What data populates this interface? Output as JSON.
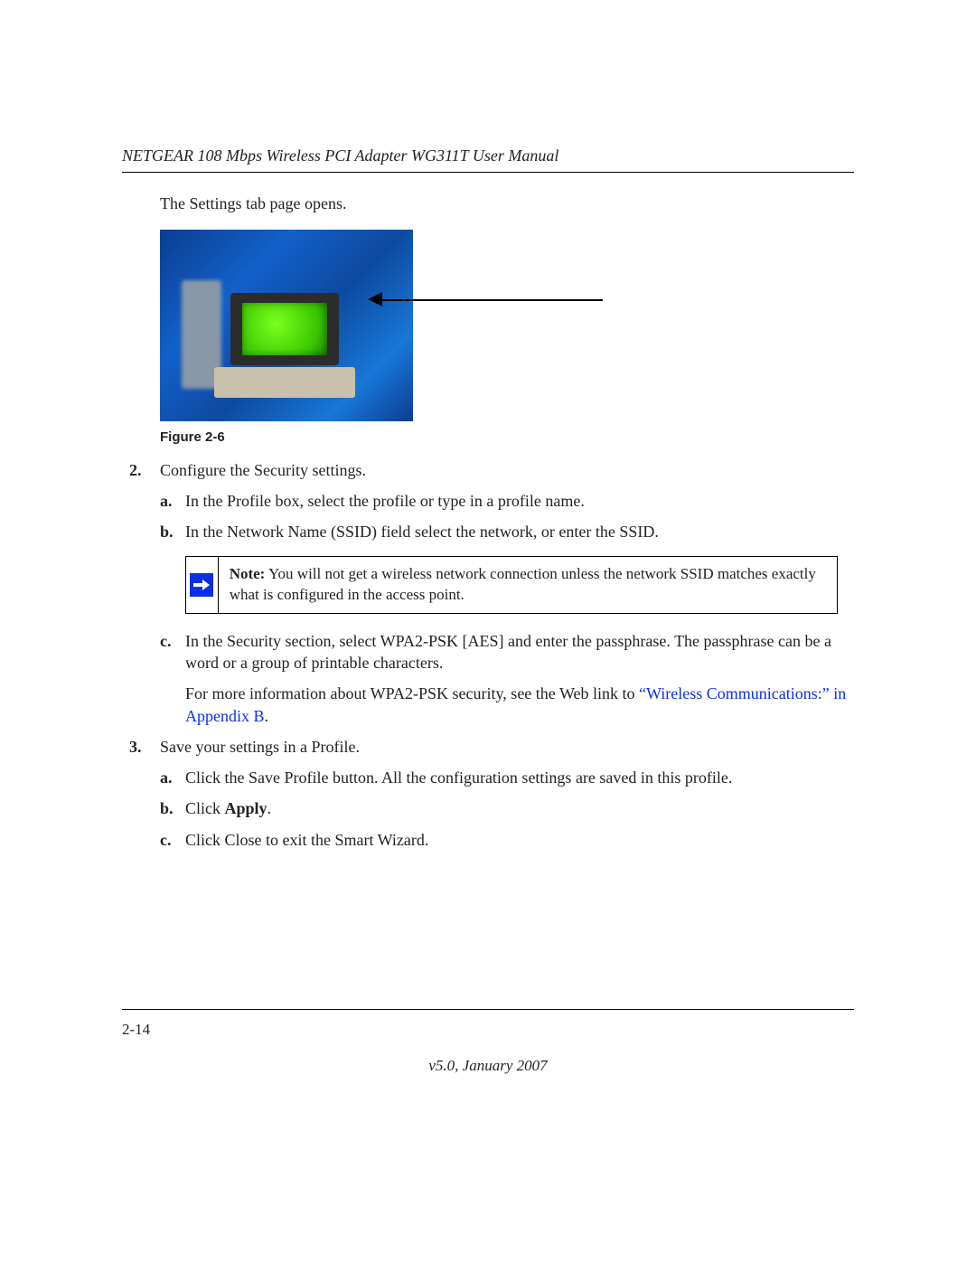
{
  "header": {
    "running_title": "NETGEAR 108 Mbps Wireless PCI Adapter WG311T User Manual"
  },
  "intro": "The Settings tab page opens.",
  "figure": {
    "caption": "Figure 2-6"
  },
  "steps": {
    "s2": {
      "marker": "2.",
      "text": "Configure the Security settings.",
      "a": {
        "marker": "a.",
        "text": "In the Profile box, select the profile or type in a profile name."
      },
      "b": {
        "marker": "b.",
        "text": "In the Network Name (SSID) field select the network, or enter the SSID."
      },
      "note": {
        "label": "Note:",
        "body": " You will not get a wireless network connection unless the network SSID matches exactly what is configured in the access point."
      },
      "c": {
        "marker": "c.",
        "text": "In the Security section, select WPA2-PSK [AES] and enter the passphrase. The passphrase can be a word or a group of printable characters."
      },
      "c_more_pre": "For more information about WPA2-PSK security, see the Web link to ",
      "c_more_link": "“Wireless Communications:” in Appendix B",
      "c_more_post": "."
    },
    "s3": {
      "marker": "3.",
      "text": "Save your settings in a Profile.",
      "a": {
        "marker": "a.",
        "text": "Click the Save Profile button. All the configuration settings are saved in this profile."
      },
      "b": {
        "marker": "b.",
        "pre": "Click ",
        "bold": "Apply",
        "post": "."
      },
      "c": {
        "marker": "c.",
        "text": "Click Close to exit the Smart Wizard."
      }
    }
  },
  "footer": {
    "page": "2-14",
    "version": "v5.0, January 2007"
  }
}
